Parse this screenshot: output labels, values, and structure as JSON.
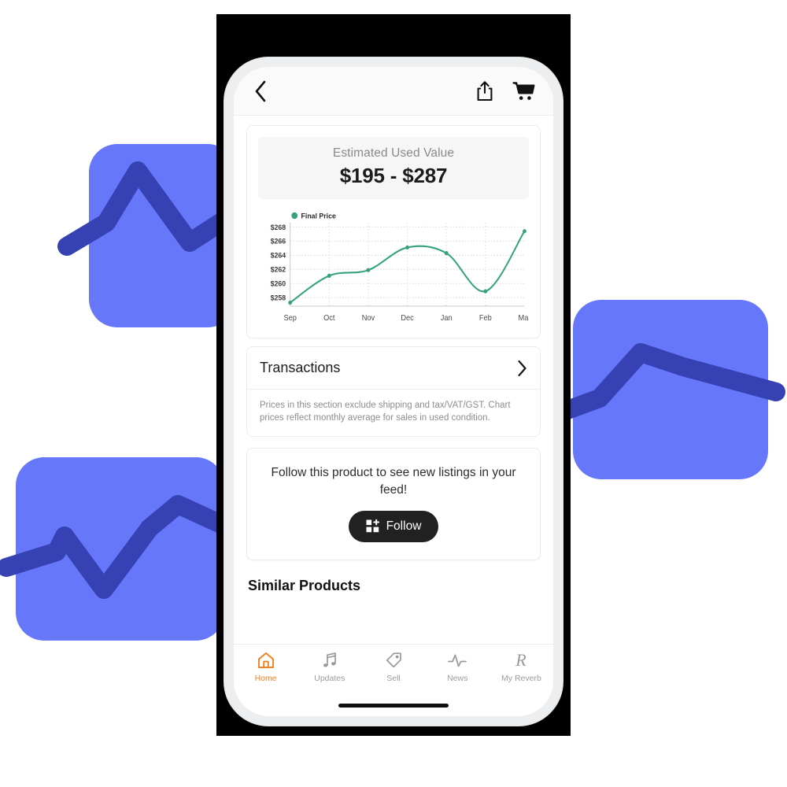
{
  "theme": {
    "accent_orange": "#f08020",
    "chart_green": "#35a277",
    "deco_light_blue": "#6677fa",
    "deco_dark_blue": "#3642b4",
    "card_gray": "#f6f6f6",
    "dark_button": "#212121"
  },
  "topbar": {
    "back_icon": "chevron-left-icon",
    "share_icon": "share-icon",
    "cart_icon": "shopping-cart-icon"
  },
  "estimated_value": {
    "label": "Estimated Used Value",
    "amount": "$195 - $287"
  },
  "chart_data": {
    "type": "line",
    "title": "",
    "legend": [
      "Final Price"
    ],
    "legend_position": "top-left",
    "categories": [
      "Sep",
      "Oct",
      "Nov",
      "Dec",
      "Jan",
      "Feb",
      "Mar"
    ],
    "series": [
      {
        "name": "Final Price",
        "color": "#35a277",
        "values": [
          257.3,
          261.1,
          261.9,
          265.1,
          264.3,
          258.9,
          267.4
        ]
      }
    ],
    "ytick_labels": [
      "$268",
      "$266",
      "$264",
      "$262",
      "$260",
      "$258"
    ],
    "ytick_values": [
      268,
      266,
      264,
      262,
      260,
      258
    ],
    "ylim": [
      256.8,
      268.6
    ],
    "xlabel": "",
    "ylabel": "",
    "grid": true,
    "markers": true,
    "curve": "smooth"
  },
  "transactions": {
    "label": "Transactions",
    "chevron_icon": "chevron-right-icon"
  },
  "disclaimer": {
    "text": "Prices in this section exclude shipping and tax/VAT/GST. Chart prices reflect monthly average for sales in used condition."
  },
  "follow": {
    "text": "Follow this product to see new listings in your feed!",
    "button_label": "Follow",
    "button_icon": "grid-plus-icon"
  },
  "similar": {
    "title": "Similar Products"
  },
  "bottom_nav": {
    "items": [
      {
        "label": "Home",
        "icon": "home-icon",
        "active": true
      },
      {
        "label": "Updates",
        "icon": "music-note-icon",
        "active": false
      },
      {
        "label": "Sell",
        "icon": "tag-icon",
        "active": false
      },
      {
        "label": "News",
        "icon": "activity-pulse-icon",
        "active": false
      },
      {
        "label": "My Reverb",
        "icon": "reverb-r-icon",
        "active": false
      }
    ]
  }
}
